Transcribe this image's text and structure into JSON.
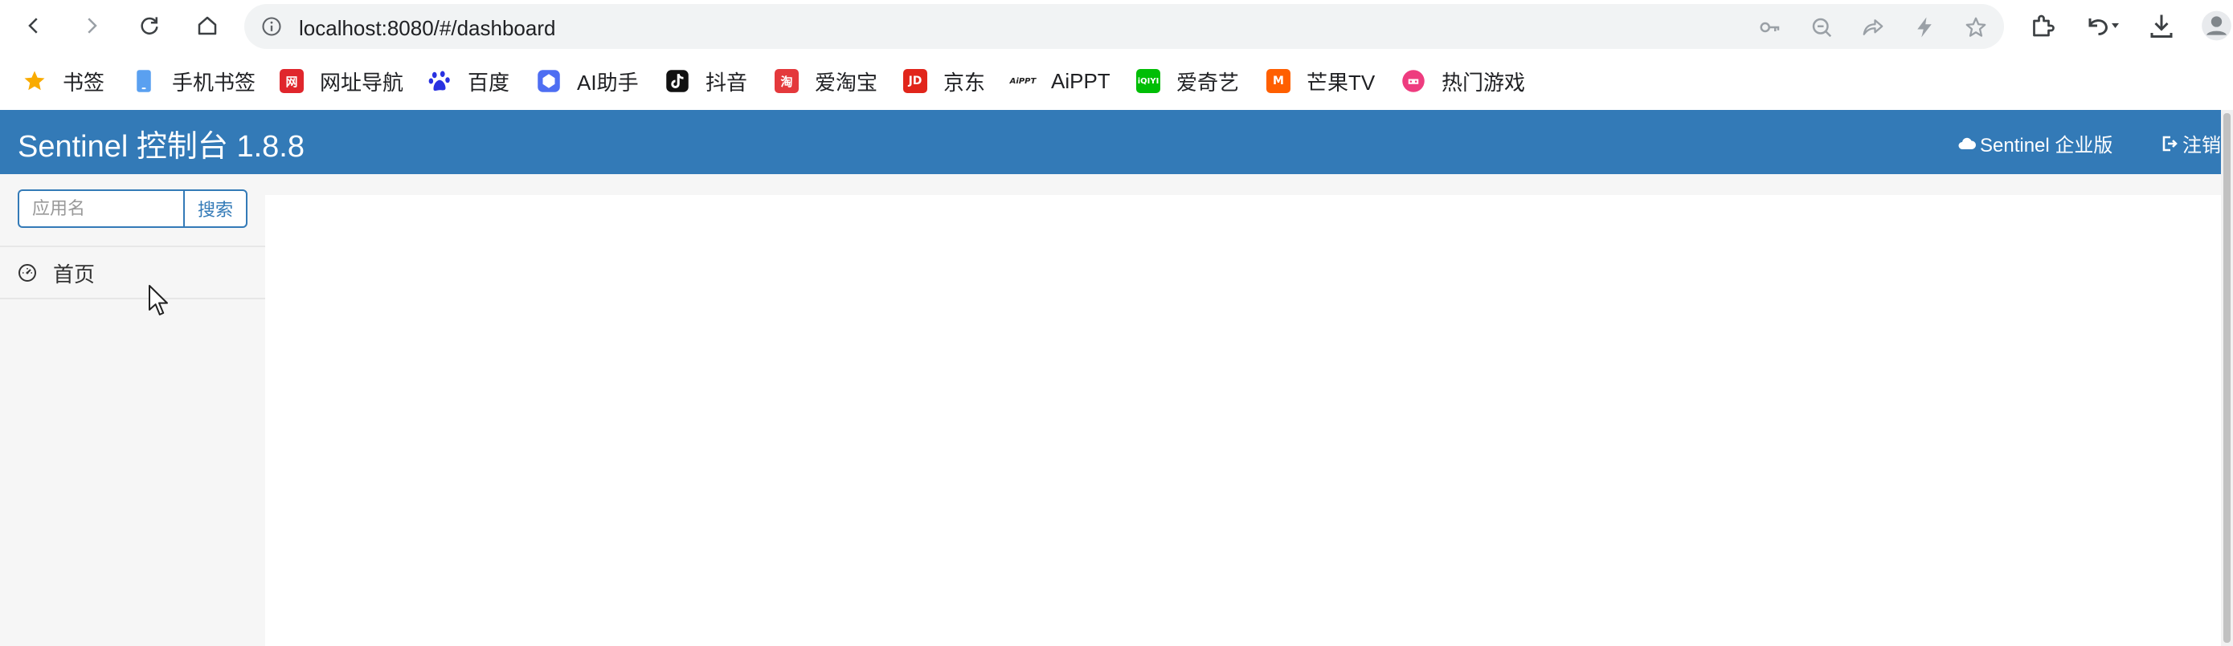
{
  "browser": {
    "url": "localhost:8080/#/dashboard"
  },
  "bookmarks": [
    {
      "label": "书签",
      "icon": "star-icon"
    },
    {
      "label": "手机书签",
      "icon": "mobile-icon"
    },
    {
      "label": "网址导航",
      "icon": "nav-logo-icon"
    },
    {
      "label": "百度",
      "icon": "baidu-icon"
    },
    {
      "label": "AI助手",
      "icon": "ai-assistant-icon"
    },
    {
      "label": "抖音",
      "icon": "douyin-icon"
    },
    {
      "label": "爱淘宝",
      "icon": "taobao-icon"
    },
    {
      "label": "京东",
      "icon": "jd-icon"
    },
    {
      "label": "AiPPT",
      "icon": "aippt-icon"
    },
    {
      "label": "爱奇艺",
      "icon": "iqiyi-icon"
    },
    {
      "label": "芒果TV",
      "icon": "mgtv-icon"
    },
    {
      "label": "热门游戏",
      "icon": "game-icon"
    }
  ],
  "app": {
    "title": "Sentinel 控制台 1.8.8",
    "enterprise_label": "Sentinel 企业版",
    "logout_label": "注销",
    "brand_color": "#337ab7"
  },
  "sidebar": {
    "search_placeholder": "应用名",
    "search_button": "搜索",
    "items": [
      {
        "label": "首页",
        "icon": "dashboard-icon"
      }
    ]
  }
}
